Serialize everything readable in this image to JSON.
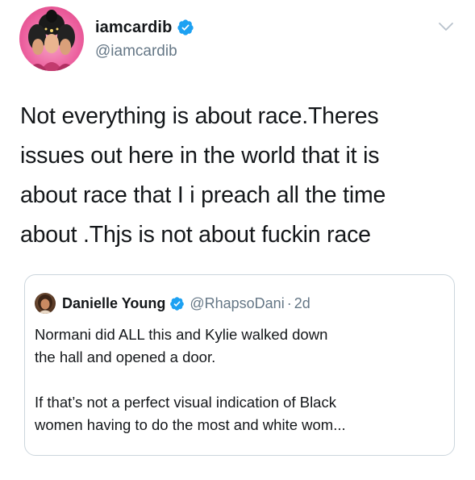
{
  "author": {
    "display_name": "iamcardib",
    "handle": "@iamcardib",
    "verified": true
  },
  "tweet": {
    "lines": [
      "Not everything is about race.Theres",
      "issues out here in the world that it is",
      "about race that I i preach all the time",
      "about .Thjs is not about fuckin race"
    ]
  },
  "quoted_tweet": {
    "display_name": "Danielle Young",
    "handle": "@RhapsoDani",
    "separator": "·",
    "time": "2d",
    "verified": true,
    "paragraph1": [
      "Normani did ALL this and Kylie walked down",
      "the hall and opened a door."
    ],
    "paragraph2": [
      "If that’s not a perfect visual indication of Black",
      "women having to do the most and white wom..."
    ]
  },
  "icons": {
    "verified": "verified-badge-icon",
    "menu": "chevron-down-icon"
  },
  "colors": {
    "verified_blue": "#1da1f2",
    "secondary_text": "#657786",
    "border": "#ccd6dd",
    "primary_text": "#14171a"
  }
}
